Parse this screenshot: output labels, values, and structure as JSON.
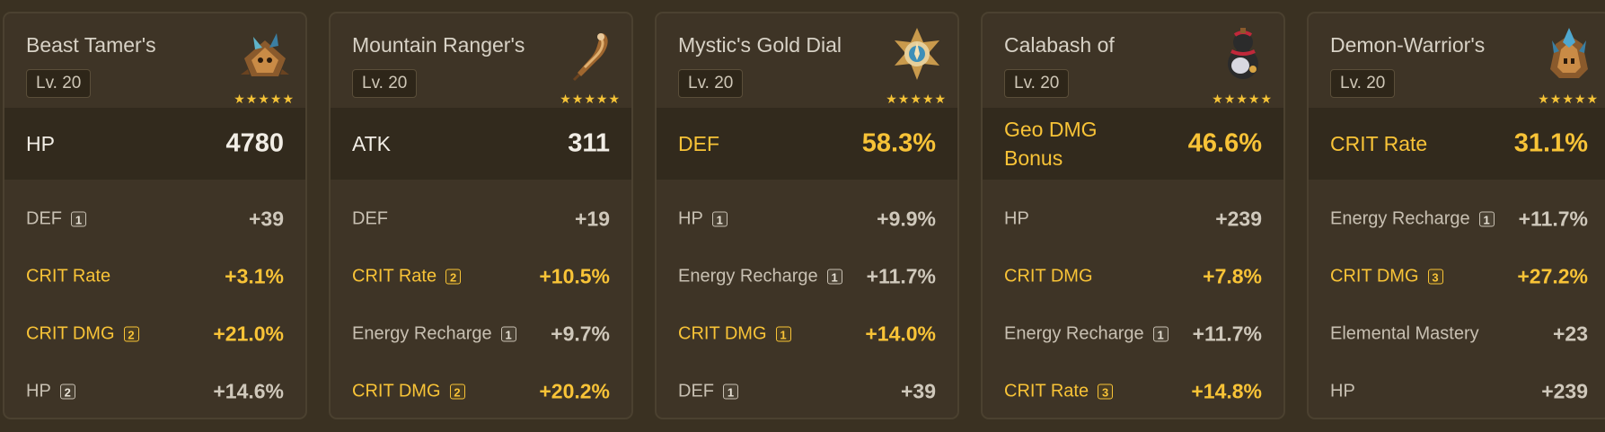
{
  "colors": {
    "background": "#3a3122",
    "card": "#3e3426",
    "main_band": "#322a1d",
    "highlight": "#f8c337",
    "text": "#c8c0b2"
  },
  "stars_glyph": "★★★★★",
  "cards": [
    {
      "name": "Beast Tamer's",
      "level": "Lv. 20",
      "icon": "beast-tamer-artifact-icon",
      "rarity": 5,
      "main": {
        "name": "HP",
        "value": "4780",
        "highlight": false
      },
      "subs": [
        {
          "name": "DEF",
          "rolls": "1",
          "value": "+39",
          "highlight": false
        },
        {
          "name": "CRIT Rate",
          "rolls": "",
          "value": "+3.1%",
          "highlight": true
        },
        {
          "name": "CRIT DMG",
          "rolls": "2",
          "value": "+21.0%",
          "highlight": true
        },
        {
          "name": "HP",
          "rolls": "2",
          "value": "+14.6%",
          "highlight": false
        }
      ]
    },
    {
      "name": "Mountain Ranger's",
      "level": "Lv. 20",
      "icon": "mountain-ranger-feather-icon",
      "rarity": 5,
      "main": {
        "name": "ATK",
        "value": "311",
        "highlight": false
      },
      "subs": [
        {
          "name": "DEF",
          "rolls": "",
          "value": "+19",
          "highlight": false
        },
        {
          "name": "CRIT Rate",
          "rolls": "2",
          "value": "+10.5%",
          "highlight": true
        },
        {
          "name": "Energy Recharge",
          "rolls": "1",
          "value": "+9.7%",
          "highlight": false
        },
        {
          "name": "CRIT DMG",
          "rolls": "2",
          "value": "+20.2%",
          "highlight": true
        }
      ]
    },
    {
      "name": "Mystic's Gold Dial",
      "level": "Lv. 20",
      "icon": "gold-dial-sands-icon",
      "rarity": 5,
      "main": {
        "name": "DEF",
        "value": "58.3%",
        "highlight": true
      },
      "subs": [
        {
          "name": "HP",
          "rolls": "1",
          "value": "+9.9%",
          "highlight": false
        },
        {
          "name": "Energy Recharge",
          "rolls": "1",
          "value": "+11.7%",
          "highlight": false
        },
        {
          "name": "CRIT DMG",
          "rolls": "1",
          "value": "+14.0%",
          "highlight": true
        },
        {
          "name": "DEF",
          "rolls": "1",
          "value": "+39",
          "highlight": false
        }
      ]
    },
    {
      "name": "Calabash of",
      "level": "Lv. 20",
      "icon": "calabash-goblet-icon",
      "rarity": 5,
      "main": {
        "name": "Geo DMG Bonus",
        "value": "46.6%",
        "highlight": true
      },
      "subs": [
        {
          "name": "HP",
          "rolls": "",
          "value": "+239",
          "highlight": false
        },
        {
          "name": "CRIT DMG",
          "rolls": "",
          "value": "+7.8%",
          "highlight": true
        },
        {
          "name": "Energy Recharge",
          "rolls": "1",
          "value": "+11.7%",
          "highlight": false
        },
        {
          "name": "CRIT Rate",
          "rolls": "3",
          "value": "+14.8%",
          "highlight": true
        }
      ]
    },
    {
      "name": "Demon-Warrior's",
      "level": "Lv. 20",
      "icon": "demon-warrior-circlet-icon",
      "rarity": 5,
      "main": {
        "name": "CRIT Rate",
        "value": "31.1%",
        "highlight": true
      },
      "subs": [
        {
          "name": "Energy Recharge",
          "rolls": "1",
          "value": "+11.7%",
          "highlight": false
        },
        {
          "name": "CRIT DMG",
          "rolls": "3",
          "value": "+27.2%",
          "highlight": true
        },
        {
          "name": "Elemental Mastery",
          "rolls": "",
          "value": "+23",
          "highlight": false
        },
        {
          "name": "HP",
          "rolls": "",
          "value": "+239",
          "highlight": false
        }
      ]
    }
  ]
}
